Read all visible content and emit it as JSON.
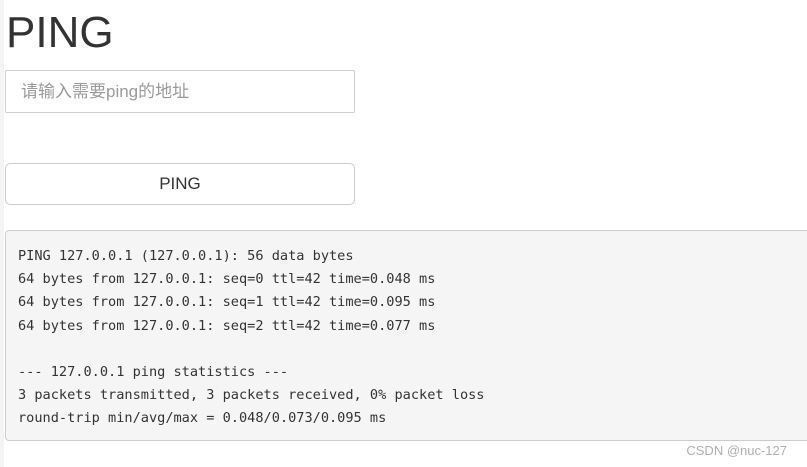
{
  "header": {
    "title": "PING"
  },
  "form": {
    "address_placeholder": "请输入需要ping的地址",
    "address_value": "",
    "ping_button_label": "PING"
  },
  "output": {
    "lines": [
      "PING 127.0.0.1 (127.0.0.1): 56 data bytes",
      "64 bytes from 127.0.0.1: seq=0 ttl=42 time=0.048 ms",
      "64 bytes from 127.0.0.1: seq=1 ttl=42 time=0.095 ms",
      "64 bytes from 127.0.0.1: seq=2 ttl=42 time=0.077 ms",
      "",
      "--- 127.0.0.1 ping statistics ---",
      "3 packets transmitted, 3 packets received, 0% packet loss",
      "round-trip min/avg/max = 0.048/0.073/0.095 ms"
    ]
  },
  "watermark": {
    "text": "CSDN @nuc-127"
  }
}
